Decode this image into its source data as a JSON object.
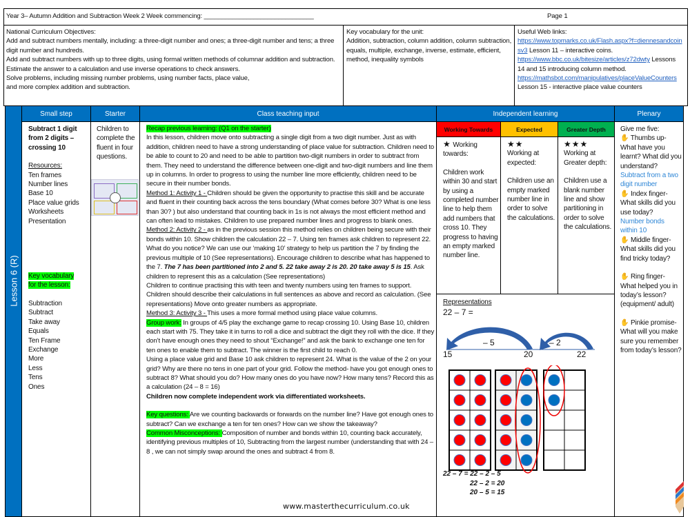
{
  "header": {
    "title": "Year 3– Autumn Addition and Subtraction Week 2   Week  commencing: _______________________________",
    "page": "Page 1"
  },
  "objectives": {
    "heading": "National Curriculum Objectives:",
    "lines": [
      "Add and subtract numbers mentally, including: a three-digit number and ones; a three-digit number and tens; a three digit number and hundreds.",
      "Add and subtract numbers with up to three digits, using formal written methods of columnar addition and subtraction.",
      "Estimate the answer to a calculation and use inverse operations to check answers.",
      "Solve problems, including missing number problems, using number facts, place value,",
      "and more complex addition and subtraction."
    ]
  },
  "vocab_unit": {
    "heading": "Key vocabulary for the unit:",
    "text": "Addition, subtraction, column addition, column subtraction, equals, multiple, exchange, inverse, estimate, efficient, method, inequality symbols"
  },
  "links": {
    "heading": "Useful Web links:",
    "items": [
      {
        "url": "https://www.topmarks.co.uk/Flash.aspx?f=diennesandcoinsv3",
        "note": " Lesson 11 – interactive coins."
      },
      {
        "url": "https://www.bbc.co.uk/bitesize/articles/z72dwty",
        "note": " Lessons 14 and 15 introducing column method."
      },
      {
        "url": "https://mathsbot.com/manipulatives/placeValueCounters",
        "note": " Lesson 15 - interactive place value counters"
      }
    ]
  },
  "columns": {
    "small_step": "Small step",
    "starter": "Starter",
    "teaching": "Class teaching input",
    "independent": "Independent learning",
    "plenary": "Plenary"
  },
  "lesson_label": "Lesson 6 (R)",
  "small_step": {
    "title": "Subtract 1 digit from 2 digits – crossing 10",
    "resources_heading": "Resources:",
    "resources": [
      "Ten frames",
      "Number lines",
      "Base 10",
      "Place value grids",
      "Worksheets",
      "Presentation"
    ],
    "vocab_heading": "Key vocabulary for the lesson:",
    "vocab": [
      "Subtraction",
      "Subtract",
      "Take away",
      "Equals",
      "Ten Frame",
      "Exchange",
      "More",
      "Less",
      "Tens",
      "Ones"
    ]
  },
  "starter": {
    "text": "Children to complete the fluent in four questions."
  },
  "teaching": {
    "recap": "Recap previous learning: (Q1 on the starter)",
    "intro": "In this lesson, children move onto  subtracting a single digit from a two digit number. Just as with addition, children need to have a strong understanding of place value for subtraction. Children need to be able to count to 20 and need to be able to partition two-digit numbers in order to subtract from them. They need to understand the difference between one-digit and two-digit numbers and line them up in columns. In order to progress to using the number line more efficiently, children need to be secure in their number bonds.",
    "m1_label": "Method 1: Activity 1 - ",
    "m1": "Children should  be given the opportunity to practise this skill and be accurate and fluent in their counting  back across the tens boundary (What comes before 30? What is one less than 30? ) but also understand that counting back in 1s is not always the most efficient method and can often lead to mistakes.  Children to use prepared number lines and progress to blank ones.",
    "m2_label": "Method 2: Activity 2 - ",
    "m2": " as in the previous session this method relies on children being secure with their bonds within 10. Show children  the calculation 22 – 7. Using ten frames ask children  to represent 22.  What do you notice?  We can use our ‘making 10’ strategy to help us partition the 7 by  finding the previous multiple of 10 (See representations). Encourage children to describe what has happened to the 7.  ",
    "m2_bold": "The 7 has been partitioned into 2 and 5.  22 take away 2  is 20.  20 take away 5 is 15",
    "m2_end": ".   Ask children to represent this as a calculation (See representations)",
    "cont": "Children to continue practising this with teen and twenty  numbers using ten frames to support. Children should describe their calculations in full sentences as above and record as calculation. (See representations) Move onto greater numbers as appropriate.",
    "m3_label": "Method 3: Activity 3 - ",
    "m3": "This uses a more formal method using place value columns.",
    "group_label": " Group work:",
    "group": " In groups of 4/5  play the exchange game to recap crossing 10. Using Base 10, children each start with 75.  They take it in turns to roll a dice and subtract the digit they roll with the dice.  If they don’t have enough ones they need to shout “Exchange!” and ask the bank to exchange one ten for ten ones to enable them to subtract.  The winner is the first child to reach 0.",
    "pv": "Using a place value grid and Base 10 ask children to represent 24. What is the value of the 2 on your grid?  Why are there no tens in one part of your grid.  Follow the method- have you got enough ones to subtract 8?  What should you do?  How many ones do you have now?  How many tens?  Record this as a calculation (24 – 8 = 16)",
    "independent": "Children now complete independent work via differentiated  worksheets.",
    "kq_label": " Key questions:  ",
    "kq": "Are we counting backwards or forwards on the number line? Have got enough ones to subtract? Can we exchange a ten for ten ones? How can we show the takeaway?",
    "mc_label": "Common Misconceptions: ",
    "mc": "Composition of number and bonds within 10, counting back accurately, identifying previous multiples of 10, Subtracting from the largest number (understanding that with 24 – 8 , we can not simply swap around the ones and subtract 4 from 8.",
    "website": "www.masterthecurriculum.co.uk"
  },
  "independent": [
    {
      "label": "Working Towards",
      "color": "#ff0000",
      "stars": "★",
      "text": " Working towards:",
      "body": "Children work within 30 and start by using a completed number line to help them add numbers that cross 10. They progress to having an empty marked number line."
    },
    {
      "label": "Expected",
      "color": "#ffc000",
      "stars": "★★",
      "text": "Working at expected:",
      "body": "Children use an empty marked number line in order to solve the calculations."
    },
    {
      "label": "Greater Depth",
      "color": "#00b050",
      "stars": "★★★",
      "text": "Working at Greater depth:",
      "body": "Children use a blank number line and show partitioning in order to solve the calculations."
    }
  ],
  "representations": {
    "heading": "Representations",
    "calc": "22 – 7 =",
    "jump1": "– 5",
    "jump2": "– 2",
    "ticks": [
      "15",
      "20",
      "22"
    ],
    "working": [
      "22 – 7 =  22 – 2 – 5",
      "22 – 2 = 20",
      "20 – 5 = 15"
    ],
    "frames": [
      {
        "red": 10,
        "blue": 0
      },
      {
        "red": 5,
        "blue": 5
      },
      {
        "red": 0,
        "blue": 2
      }
    ]
  },
  "plenary": {
    "intro": "Give me five:",
    "items": [
      {
        "prompt": " Thumbs up- What have you learnt? What did you understand?",
        "answer": "Subtract from a two digit number"
      },
      {
        "prompt": " Index finger- What skills did you use today?",
        "answer": "Number bonds within 10"
      },
      {
        "prompt": " Middle finger- What skills did you find tricky today?",
        "answer": ""
      },
      {
        "prompt": " Ring finger- What helped you in today’s lesson? (equipment/ adult)",
        "answer": ""
      },
      {
        "prompt": " Pinkie promise- What will you make sure you remember from today’s lesson?",
        "answer": ""
      }
    ]
  },
  "colors": {
    "header_blue": "#0070c0",
    "highlight": "#00ff00",
    "dot_red": "#ff0000",
    "dot_blue": "#0070c0",
    "arrow": "#2f5fa8"
  }
}
